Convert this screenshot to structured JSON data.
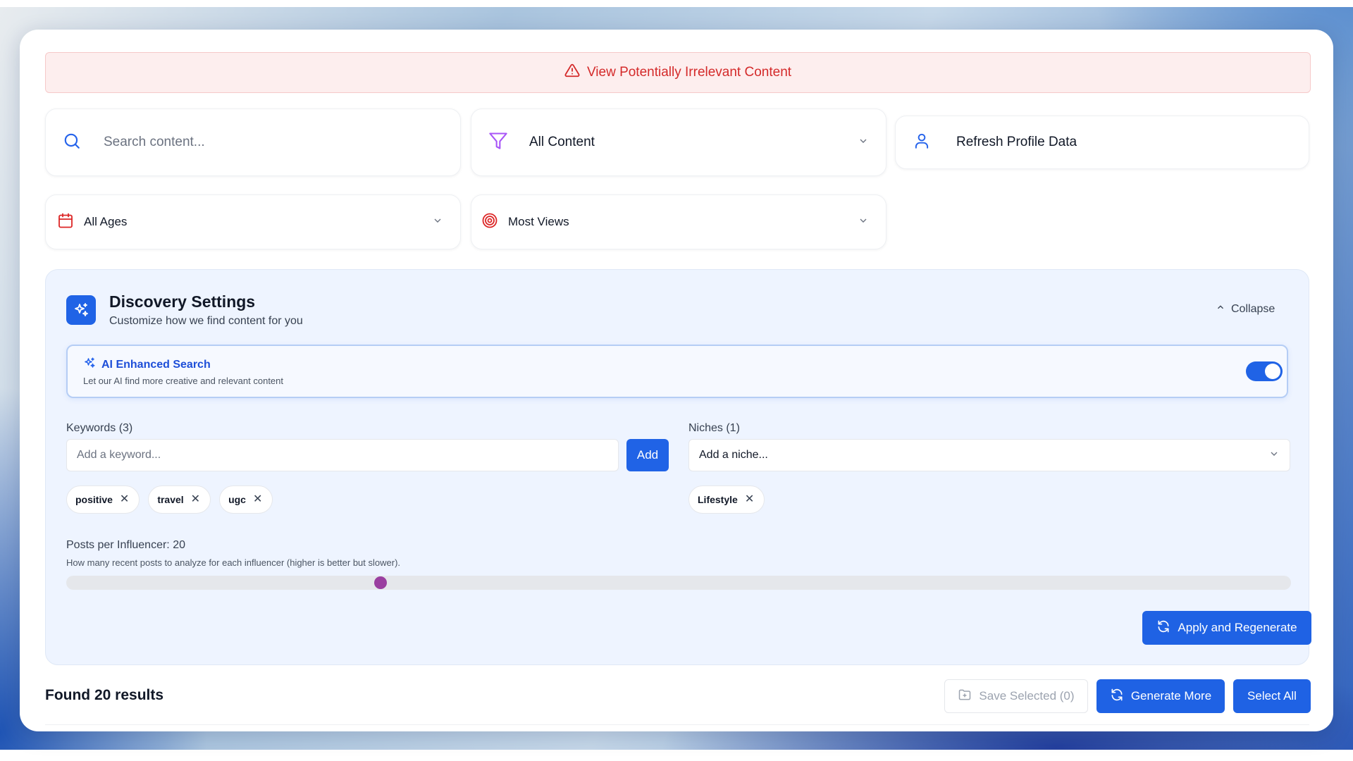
{
  "alert": {
    "text": "View Potentially Irrelevant Content",
    "icon": "warning-triangle-icon",
    "color": "#d42a2a"
  },
  "filters": {
    "search": {
      "placeholder": "Search content...",
      "value": "",
      "icon": "search-icon"
    },
    "content_type": {
      "selected": "All Content",
      "icon": "filter-icon"
    },
    "refresh": {
      "label": "Refresh Profile Data",
      "icon": "user-icon"
    },
    "age": {
      "selected": "All Ages",
      "icon": "calendar-icon"
    },
    "sort": {
      "selected": "Most Views",
      "icon": "target-icon"
    }
  },
  "discovery": {
    "title": "Discovery Settings",
    "subtitle": "Customize how we find content for you",
    "collapse_label": "Collapse",
    "ai": {
      "title": "AI Enhanced Search",
      "subtitle": "Let our AI find more creative and relevant content",
      "enabled": true
    },
    "keywords": {
      "label": "Keywords (3)",
      "placeholder": "Add a keyword...",
      "add_label": "Add",
      "items": [
        "positive",
        "travel",
        "ugc"
      ]
    },
    "niches": {
      "label": "Niches (1)",
      "placeholder": "Add a niche...",
      "items": [
        "Lifestyle"
      ]
    },
    "posts_per_influencer": {
      "label": "Posts per Influencer: 20",
      "value": 20,
      "description": "How many recent posts to analyze for each influencer (higher is better but slower)."
    },
    "apply_label": "Apply and Regenerate"
  },
  "results": {
    "found_text": "Found 20 results",
    "save_selected_label": "Save Selected (0)",
    "generate_more_label": "Generate More",
    "select_all_label": "Select All"
  },
  "colors": {
    "primary": "#1f62e4",
    "panel_bg": "#eef4ff",
    "slider_thumb": "#9a3fa0",
    "filter_icon": "#a855f7"
  }
}
